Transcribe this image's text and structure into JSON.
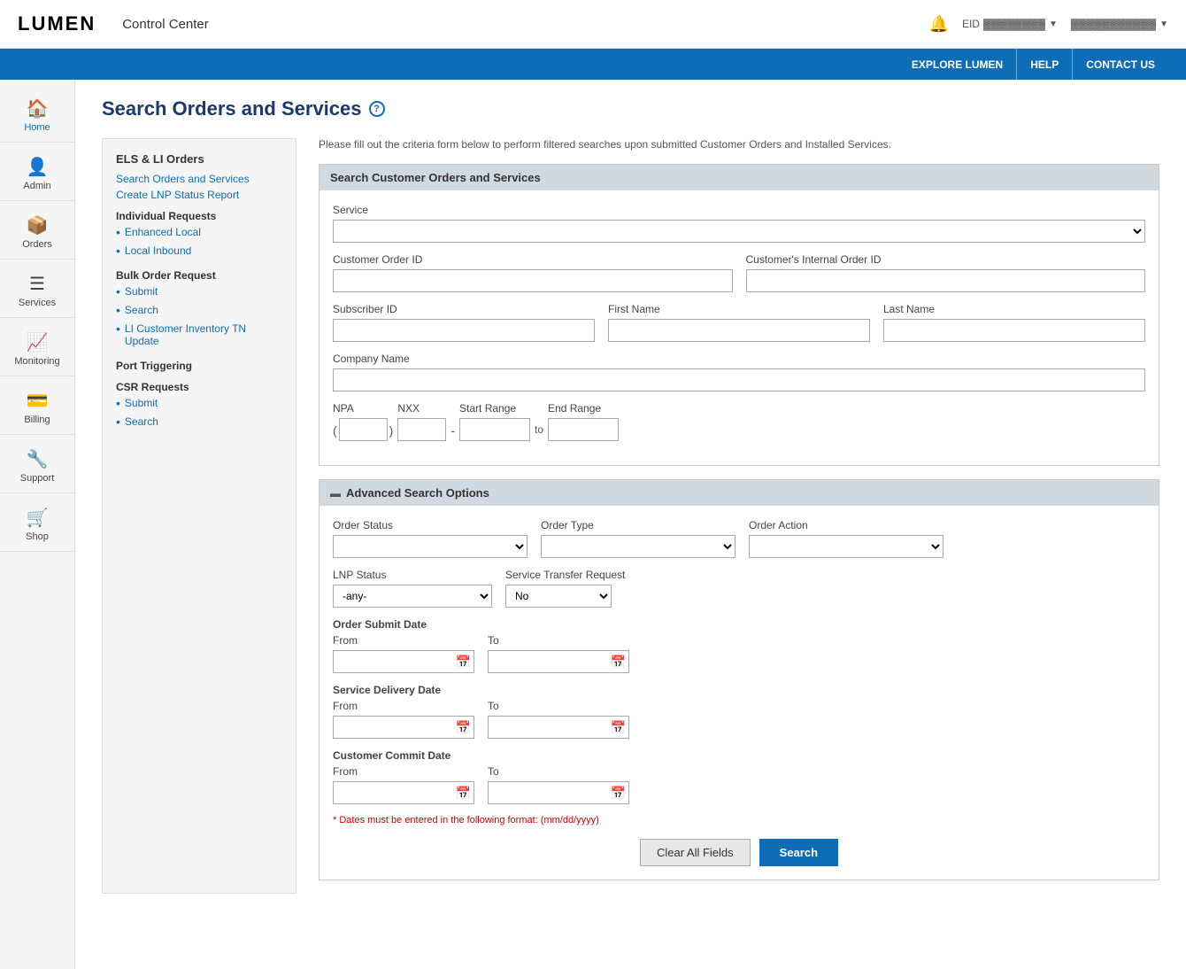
{
  "app": {
    "logo": "LUMEN",
    "title": "Control Center"
  },
  "topnav": {
    "explore": "EXPLORE LUMEN",
    "help": "HELP",
    "contact": "CONTACT US"
  },
  "eid": {
    "label": "EID",
    "value": "▓▓▓▓▓▓▓▓",
    "user": "▓▓▓▓▓▓▓▓▓▓▓"
  },
  "sidebar": {
    "items": [
      {
        "icon": "🏠",
        "label": "Home"
      },
      {
        "icon": "👤",
        "label": "Admin"
      },
      {
        "icon": "📦",
        "label": "Orders"
      },
      {
        "icon": "☰",
        "label": "Services"
      },
      {
        "icon": "📈",
        "label": "Monitoring"
      },
      {
        "icon": "💳",
        "label": "Billing"
      },
      {
        "icon": "🔧",
        "label": "Support"
      },
      {
        "icon": "🛒",
        "label": "Shop"
      }
    ]
  },
  "page": {
    "title": "Search Orders and Services",
    "description": "Please fill out the criteria form below to perform filtered searches upon submitted Customer Orders and Installed Services."
  },
  "leftmenu": {
    "section_title": "ELS & LI Orders",
    "links": [
      "Search Orders and Services",
      "Create LNP Status Report"
    ],
    "individual_requests": {
      "title": "Individual Requests",
      "items": [
        "Enhanced Local",
        "Local Inbound"
      ]
    },
    "bulk_order": {
      "title": "Bulk Order Request",
      "items": [
        "Submit",
        "Search",
        "LI Customer Inventory TN Update"
      ]
    },
    "port_triggering": "Port Triggering",
    "csr_requests": {
      "title": "CSR Requests",
      "items": [
        "Submit",
        "Search"
      ]
    }
  },
  "search_section": {
    "title": "Search Customer Orders and Services",
    "service_label": "Service",
    "customer_order_id_label": "Customer Order ID",
    "customers_internal_order_id_label": "Customer's Internal Order ID",
    "subscriber_id_label": "Subscriber ID",
    "first_name_label": "First Name",
    "last_name_label": "Last Name",
    "company_name_label": "Company Name",
    "npa_label": "NPA",
    "nxx_label": "NXX",
    "start_range_label": "Start Range",
    "end_range_label": "End Range"
  },
  "advanced_section": {
    "title": "Advanced Search Options",
    "order_status_label": "Order Status",
    "order_type_label": "Order Type",
    "order_action_label": "Order Action",
    "lnp_status_label": "LNP Status",
    "lnp_status_default": "-any-",
    "service_transfer_label": "Service Transfer Request",
    "service_transfer_default": "No",
    "order_submit_date_label": "Order Submit Date",
    "service_delivery_date_label": "Service Delivery Date",
    "customer_commit_date_label": "Customer Commit Date",
    "from_label": "From",
    "to_label": "To",
    "dates_note": "* Dates must be entered in the following format: (mm/dd/yyyy)"
  },
  "buttons": {
    "clear": "Clear All Fields",
    "search": "Search"
  }
}
